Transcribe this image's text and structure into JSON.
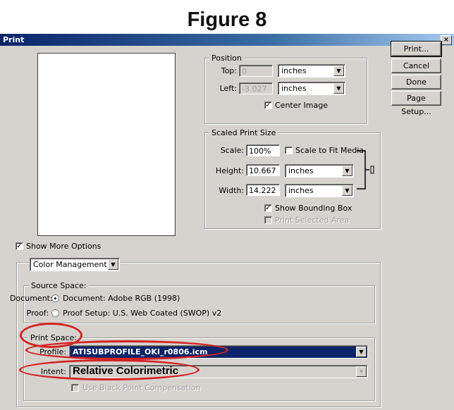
{
  "figure_title": "Figure 8",
  "window": {
    "title": "Print",
    "close_glyph": "×"
  },
  "buttons": {
    "print": "Print...",
    "cancel": "Cancel",
    "done": "Done",
    "page_setup": "Page Setup..."
  },
  "position": {
    "group_label": "Position",
    "top_label": "Top:",
    "top_value": "0",
    "top_unit": "inches",
    "left_label": "Left:",
    "left_value": "-3.027",
    "left_unit": "inches",
    "center_image_label": "Center Image",
    "center_image_checked": true
  },
  "scaled": {
    "group_label": "Scaled Print Size",
    "scale_label": "Scale:",
    "scale_value": "100%",
    "scale_to_fit_label": "Scale to Fit Media",
    "height_label": "Height:",
    "height_value": "10.667",
    "height_unit": "inches",
    "width_label": "Width:",
    "width_value": "14.222",
    "width_unit": "inches",
    "show_bounding_label": "Show Bounding Box",
    "print_selected_label": "Print Selected Area"
  },
  "show_more_label": "Show More Options",
  "color_mgmt": {
    "value": "Color Management"
  },
  "source": {
    "group_label": "Source Space:",
    "document_label": "Document:",
    "document_option": "Document:  Adobe RGB (1998)",
    "proof_label": "Proof:",
    "proof_option": "Proof Setup:  U.S. Web Coated (SWOP) v2"
  },
  "print_space": {
    "group_label": "Print Space:",
    "profile_label": "Profile:",
    "profile_value": "ATISUBPROFILE_OKI_r0806.icm",
    "intent_label": "Intent:",
    "intent_value": "Relative Colorimetric",
    "black_point_label": "Use Black Point Compensation"
  },
  "colors": {
    "highlight": "#0a246a",
    "oval": "#d42323",
    "face": "#d6d3ce"
  }
}
